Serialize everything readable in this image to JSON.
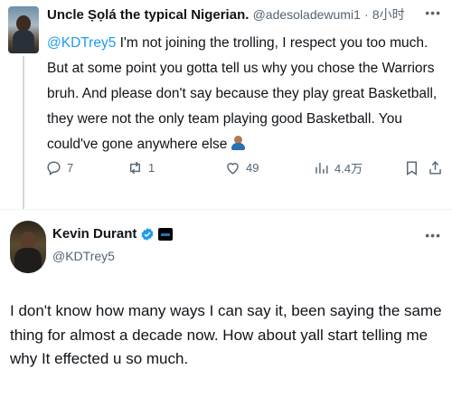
{
  "tweet1": {
    "display_name": "Uncle Ṣọlá the typical Nigerian.",
    "handle": "@adesoladewumi1",
    "separator": "·",
    "time": "8小时",
    "mention": "@KDTrey5",
    "body": " I'm not joining the trolling, I respect you too much. But at some point you gotta tell us why you chose the Warriors bruh. And please don't say because they play great Basketball, they were not the only team playing good Basketball. You could've gone anywhere else",
    "trailing_emoji": "person-shrugging-emoji",
    "actions": {
      "replies": "7",
      "reposts": "1",
      "likes": "49",
      "views": "4.4万"
    }
  },
  "tweet2": {
    "display_name": "Kevin Durant",
    "handle": "@KDTrey5",
    "body": "I don't know how many ways I can say it, been saying the same thing for almost a decade now. How about yall start telling me why It effected u so much."
  },
  "icons": {
    "reply": "reply-icon",
    "repost": "repost-icon",
    "like": "heart-icon",
    "views": "views-icon",
    "bookmark": "bookmark-icon",
    "share": "share-icon",
    "more": "more-icon",
    "verified": "verified-badge-icon",
    "affiliate": "affiliate-badge-icon"
  },
  "colors": {
    "link": "#1d9bf0",
    "secondary_text": "#536471",
    "primary_text": "#0f1419"
  }
}
